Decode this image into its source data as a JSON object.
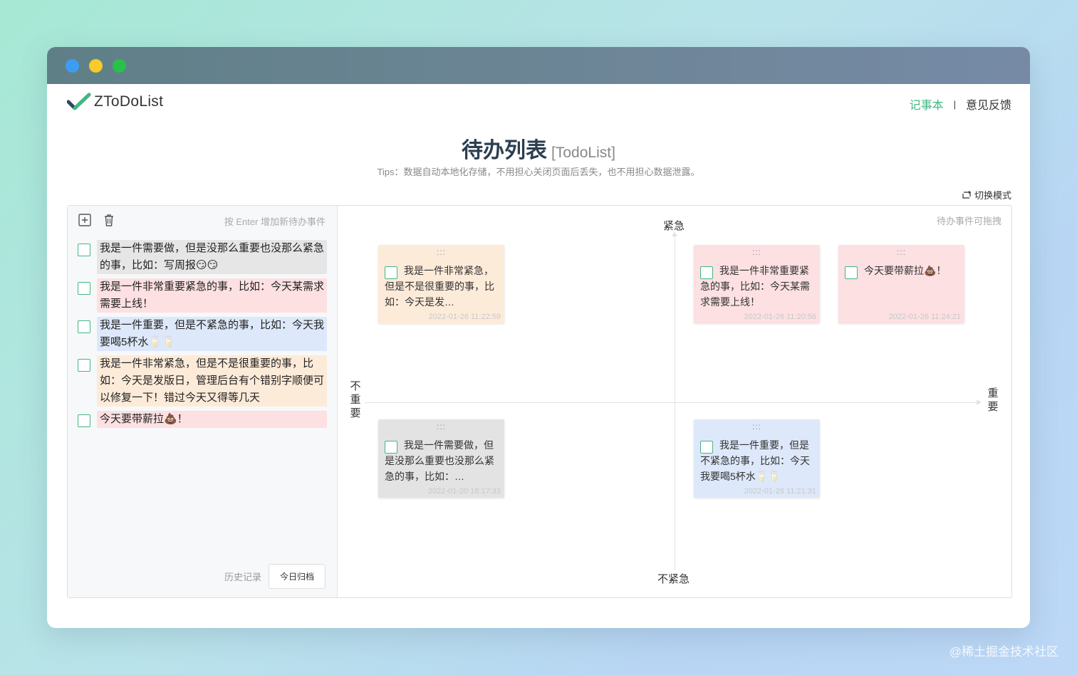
{
  "app": {
    "name": "ZToDoList"
  },
  "nav": {
    "notebook": "记事本",
    "separator": "|",
    "feedback": "意见反馈"
  },
  "page": {
    "title": "待办列表",
    "subtitle": "[TodoList]",
    "tips": "Tips：数据自动本地化存储，不用担心关闭页面后丢失，也不用担心数据泄露。",
    "switch_mode": "切换模式"
  },
  "left_panel": {
    "input_hint": "按 Enter 增加新待办事件",
    "items": [
      {
        "text": "我是一件需要做，但是没那么重要也没那么紧急的事，比如：写周报😏😏",
        "color": "#e6e6e6"
      },
      {
        "text": "我是一件非常重要紧急的事，比如：今天某需求需要上线！",
        "color": "#fce0e2"
      },
      {
        "text": "我是一件重要，但是不紧急的事，比如：今天我要喝5杯水🥛🥛",
        "color": "#dde8fa"
      },
      {
        "text": "我是一件非常紧急，但是不是很重要的事，比如：今天是发版日，管理后台有个错别字顺便可以修复一下！错过今天又得等几天",
        "color": "#fdebd9"
      },
      {
        "text": "今天要带薪拉💩！",
        "color": "#fce0e2"
      }
    ],
    "history_label": "历史记录",
    "archive_label": "今日归档"
  },
  "matrix": {
    "drag_hint": "待办事件可拖拽",
    "axis": {
      "top": "紧急",
      "bottom": "不紧急",
      "left": "不重要",
      "right": "重要"
    },
    "grip": ":::",
    "cards": [
      {
        "text": "我是一件非常紧急，但是不是很重要的事，比如：今天是发…",
        "date": "2022-01-26 11:22:59",
        "color": "orange"
      },
      {
        "text": "我是一件非常重要紧急的事，比如：今天某需求需要上线！",
        "date": "2022-01-26 11:20:56",
        "color": "red"
      },
      {
        "text": "今天要带薪拉💩！",
        "date": "2022-01-26 11:24:21",
        "color": "red"
      },
      {
        "text": "我是一件需要做，但是没那么重要也没那么紧急的事，比如：…",
        "date": "2022-01-20 18:17:33",
        "color": "gray"
      },
      {
        "text": "我是一件重要，但是不紧急的事，比如：今天我要喝5杯水🥛🥛",
        "date": "2022-01-26 11:21:31",
        "color": "blue"
      }
    ]
  },
  "watermark": "@稀土掘金技术社区",
  "colors": {
    "accent": "#41b883",
    "title": "#2c3e50"
  }
}
